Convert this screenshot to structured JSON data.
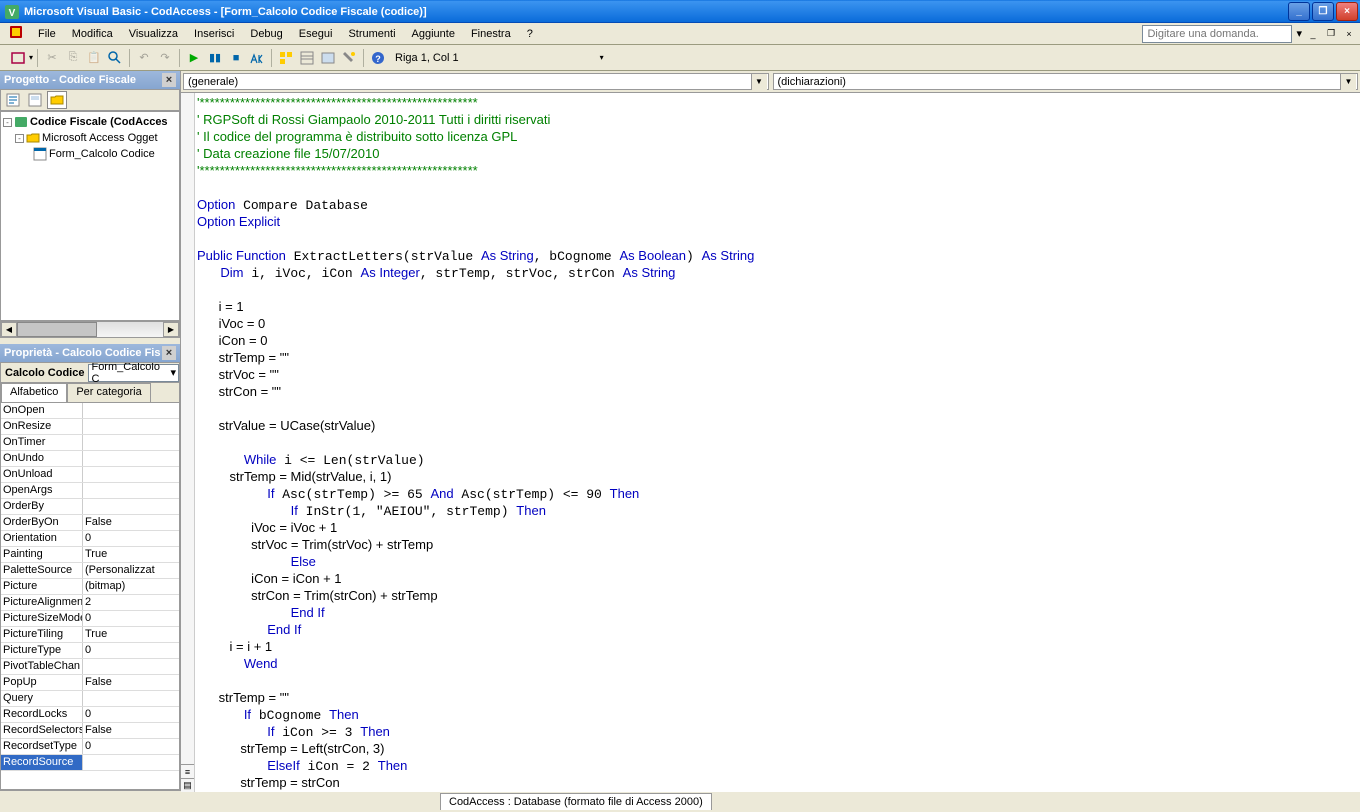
{
  "titlebar": {
    "text": "Microsoft Visual Basic - CodAccess - [Form_Calcolo Codice Fiscale (codice)]"
  },
  "menus": [
    "File",
    "Modifica",
    "Visualizza",
    "Inserisci",
    "Debug",
    "Esegui",
    "Strumenti",
    "Aggiunte",
    "Finestra",
    "?"
  ],
  "menu_underlines": [
    "F",
    "M",
    "V",
    "I",
    "D",
    "E",
    "S",
    "A",
    "n",
    "?"
  ],
  "askbox_placeholder": "Digitare una domanda.",
  "cursor_pos": "Riga 1, Col 1",
  "project_panel": {
    "title": "Progetto - Codice Fiscale"
  },
  "tree": {
    "root": "Codice Fiscale (CodAcces",
    "node1": "Microsoft Access Ogget",
    "node2": "Form_Calcolo Codice"
  },
  "prop_panel": {
    "title": "Proprietà - Calcolo Codice Fis"
  },
  "prop_obj": {
    "name": "Calcolo Codice",
    "type": "Form_Calcolo C"
  },
  "tabs": {
    "a": "Alfabetico",
    "b": "Per categoria"
  },
  "properties": [
    {
      "n": "OnOpen",
      "v": ""
    },
    {
      "n": "OnResize",
      "v": ""
    },
    {
      "n": "OnTimer",
      "v": ""
    },
    {
      "n": "OnUndo",
      "v": ""
    },
    {
      "n": "OnUnload",
      "v": ""
    },
    {
      "n": "OpenArgs",
      "v": ""
    },
    {
      "n": "OrderBy",
      "v": ""
    },
    {
      "n": "OrderByOn",
      "v": "False"
    },
    {
      "n": "Orientation",
      "v": "0"
    },
    {
      "n": "Painting",
      "v": "True"
    },
    {
      "n": "PaletteSource",
      "v": "(Personalizzat"
    },
    {
      "n": "Picture",
      "v": "(bitmap)"
    },
    {
      "n": "PictureAlignmen",
      "v": "2"
    },
    {
      "n": "PictureSizeMode",
      "v": "0"
    },
    {
      "n": "PictureTiling",
      "v": "True"
    },
    {
      "n": "PictureType",
      "v": "0"
    },
    {
      "n": "PivotTableChan",
      "v": ""
    },
    {
      "n": "PopUp",
      "v": "False"
    },
    {
      "n": "Query",
      "v": ""
    },
    {
      "n": "RecordLocks",
      "v": "0"
    },
    {
      "n": "RecordSelectors",
      "v": "False"
    },
    {
      "n": "RecordsetType",
      "v": "0"
    },
    {
      "n": "RecordSource",
      "v": "",
      "sel": true
    }
  ],
  "combo_left": "(generale)",
  "combo_right": "(dichiarazioni)",
  "code_lines": [
    {
      "t": "'*******************************************************",
      "c": "comment"
    },
    {
      "t": "' RGPSoft di Rossi Giampaolo 2010-2011 Tutti i diritti riservati",
      "c": "comment"
    },
    {
      "t": "' Il codice del programma è distribuito sotto licenza GPL",
      "c": "comment"
    },
    {
      "t": "' Data creazione file 15/07/2010",
      "c": "comment"
    },
    {
      "t": "'*******************************************************",
      "c": "comment"
    },
    {
      "t": "",
      "c": ""
    },
    {
      "pre": "",
      "kw": "Option",
      "rest": " Compare Database"
    },
    {
      "pre": "",
      "kw": "Option Explicit",
      "rest": ""
    },
    {
      "t": "",
      "c": ""
    },
    {
      "raw": "<span class='c-kw'>Public Function</span> ExtractLetters(strValue <span class='c-kw'>As String</span>, bCognome <span class='c-kw'>As Boolean</span>) <span class='c-kw'>As String</span>"
    },
    {
      "raw": "   <span class='c-kw'>Dim</span> i, iVoc, iCon <span class='c-kw'>As Integer</span>, strTemp, strVoc, strCon <span class='c-kw'>As String</span>"
    },
    {
      "t": "",
      "c": ""
    },
    {
      "t": "      i = 1",
      "c": ""
    },
    {
      "t": "      iVoc = 0",
      "c": ""
    },
    {
      "t": "      iCon = 0",
      "c": ""
    },
    {
      "t": "      strTemp = \"\"",
      "c": ""
    },
    {
      "t": "      strVoc = \"\"",
      "c": ""
    },
    {
      "t": "      strCon = \"\"",
      "c": ""
    },
    {
      "t": "",
      "c": ""
    },
    {
      "t": "      strValue = UCase(strValue)",
      "c": ""
    },
    {
      "t": "",
      "c": ""
    },
    {
      "raw": "      <span class='c-kw'>While</span> i &lt;= Len(strValue)"
    },
    {
      "t": "         strTemp = Mid(strValue, i, 1)",
      "c": ""
    },
    {
      "raw": "         <span class='c-kw'>If</span> Asc(strTemp) &gt;= 65 <span class='c-kw'>And</span> Asc(strTemp) &lt;= 90 <span class='c-kw'>Then</span>"
    },
    {
      "raw": "            <span class='c-kw'>If</span> InStr(1, \"AEIOU\", strTemp) <span class='c-kw'>Then</span>"
    },
    {
      "t": "               iVoc = iVoc + 1",
      "c": ""
    },
    {
      "t": "               strVoc = Trim(strVoc) + strTemp",
      "c": ""
    },
    {
      "raw": "            <span class='c-kw'>Else</span>"
    },
    {
      "t": "               iCon = iCon + 1",
      "c": ""
    },
    {
      "t": "               strCon = Trim(strCon) + strTemp",
      "c": ""
    },
    {
      "raw": "            <span class='c-kw'>End If</span>"
    },
    {
      "raw": "         <span class='c-kw'>End If</span>"
    },
    {
      "t": "         i = i + 1",
      "c": ""
    },
    {
      "raw": "      <span class='c-kw'>Wend</span>"
    },
    {
      "t": "",
      "c": ""
    },
    {
      "t": "      strTemp = \"\"",
      "c": ""
    },
    {
      "raw": "      <span class='c-kw'>If</span> bCognome <span class='c-kw'>Then</span>"
    },
    {
      "raw": "         <span class='c-kw'>If</span> iCon &gt;= 3 <span class='c-kw'>Then</span>"
    },
    {
      "t": "            strTemp = Left(strCon, 3)",
      "c": ""
    },
    {
      "raw": "         <span class='c-kw'>ElseIf</span> iCon = 2 <span class='c-kw'>Then</span>"
    },
    {
      "t": "            strTemp = strCon",
      "c": ""
    }
  ],
  "bottom_tab": "CodAccess : Database (formato file di Access 2000)"
}
